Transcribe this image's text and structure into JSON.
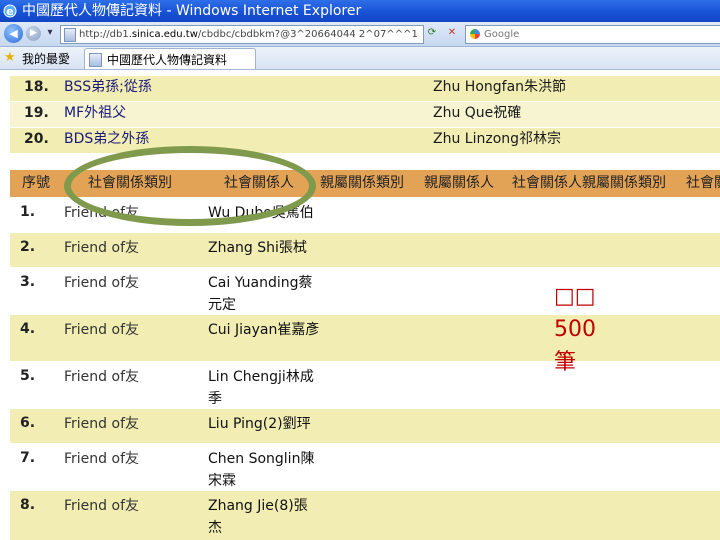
{
  "window": {
    "title": "中國歷代人物傳記資料 - Windows Internet Explorer",
    "address": {
      "prefix": "http://db1.",
      "host": "sinica.edu.tw",
      "path": "/cbdbc/cbdbkm?@3^20664044 2^07^^^1"
    },
    "search_placeholder": "Google",
    "favorites_label": "我的最愛",
    "tab_label": "中國歷代人物傳記資料"
  },
  "top_rows": [
    {
      "num": "18.",
      "code": "BSS弟孫;從孫",
      "name": "Zhu Hongfan朱洪節"
    },
    {
      "num": "19.",
      "code": "MF外祖父",
      "name": "Zhu Que祝確"
    },
    {
      "num": "20.",
      "code": "BDS弟之外孫",
      "name": "Zhu Linzong祁林宗"
    }
  ],
  "headers": [
    "序號",
    "社會關係類別",
    "社會關係人",
    "親屬關係類別",
    "親屬關係人",
    "社會關係人親屬關係類別",
    "社會關"
  ],
  "rows": [
    {
      "num": "1.",
      "category": "Friend of友",
      "person": "Wu Dubo吳篤伯"
    },
    {
      "num": "2.",
      "category": "Friend of友",
      "person": "Zhang Shi張栻"
    },
    {
      "num": "3.",
      "category": "Friend of友",
      "person": "Cai Yuanding蔡元定"
    },
    {
      "num": "4.",
      "category": "Friend of友",
      "person": "Cui Jiayan崔嘉彥"
    },
    {
      "num": "5.",
      "category": "Friend of友",
      "person": "Lin Chengji林成季"
    },
    {
      "num": "6.",
      "category": "Friend of友",
      "person": "Liu Ping(2)劉玶"
    },
    {
      "num": "7.",
      "category": "Friend of友",
      "person": "Chen Songlin陳宋霖"
    },
    {
      "num": "8.",
      "category": "Friend of友",
      "person": "Zhang Jie(8)張杰"
    }
  ],
  "annotation": {
    "line1": "□□",
    "line2": "500",
    "line3": "筆"
  },
  "colors": {
    "row_light": "#f7f4d2",
    "row_yellow": "#f2edb3",
    "header": "#e2a356",
    "oval": "#7f9a4c",
    "annotation": "#c00000"
  }
}
